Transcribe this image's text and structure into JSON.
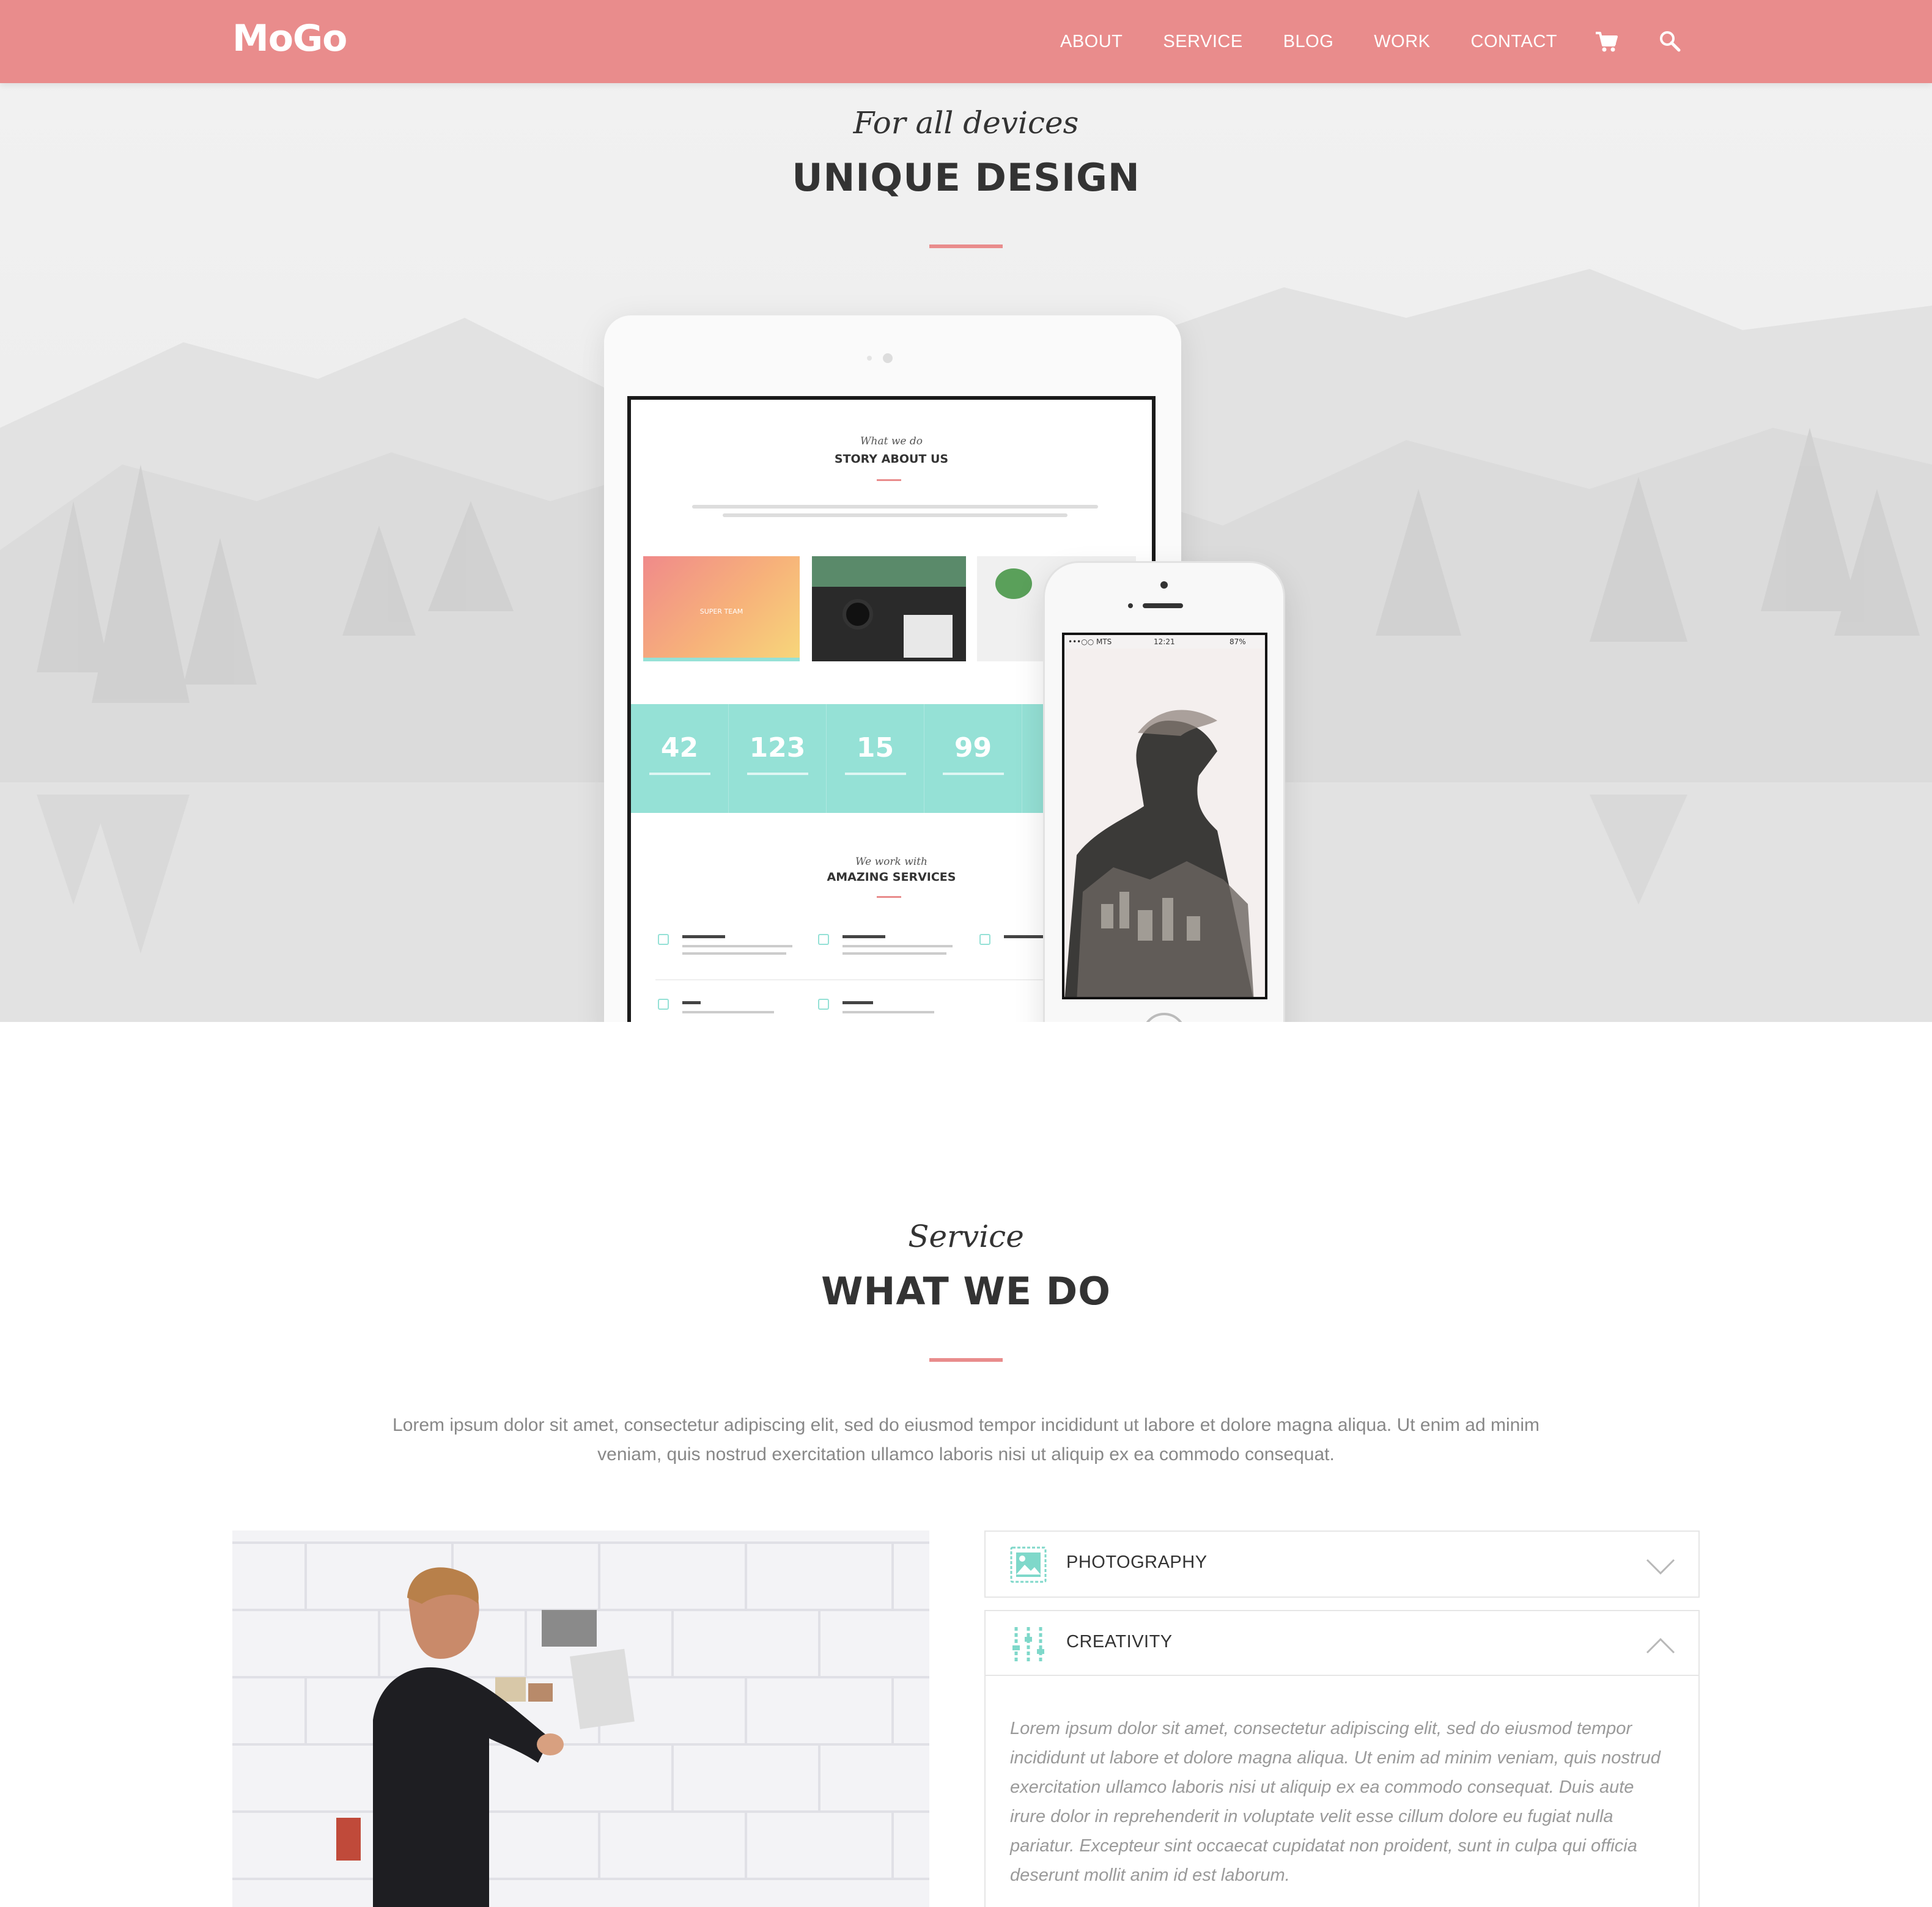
{
  "header": {
    "logo": "MoGo",
    "nav": [
      "ABOUT",
      "SERVICE",
      "BLOG",
      "WORK",
      "CONTACT"
    ],
    "icons": [
      "cart-icon",
      "search-icon"
    ]
  },
  "hero": {
    "script_title": "For all devices",
    "title": "UNIQUE DESIGN",
    "tablet": {
      "script": "What we do",
      "title": "STORY ABOUT US",
      "card_label": "SUPER TEAM",
      "stats": [
        {
          "value": "42"
        },
        {
          "value": "123"
        },
        {
          "value": "15"
        },
        {
          "value": "99"
        }
      ],
      "services_script": "We work with",
      "services_title": "AMAZING SERVICES"
    },
    "phone": {
      "carrier": "•••○○ MTS",
      "time": "12:21",
      "battery": "87%"
    }
  },
  "service": {
    "script_title": "Service",
    "title": "WHAT WE DO",
    "intro": "Lorem ipsum dolor sit amet, consectetur adipiscing elit, sed do eiusmod tempor incididunt ut labore et dolore magna aliqua. Ut enim ad minim veniam, quis nostrud exercitation ullamco laboris nisi ut aliquip ex ea commodo consequat.",
    "accordion": [
      {
        "title": "PHOTOGRAPHY",
        "icon": "image-icon",
        "expanded": false
      },
      {
        "title": "CREATIVITY",
        "icon": "equalizer-icon",
        "expanded": true,
        "body": "Lorem ipsum dolor sit amet, consectetur adipiscing elit, sed do eiusmod tempor incididunt ut labore et dolore magna aliqua. Ut enim ad minim veniam, quis nostrud exercitation ullamco laboris nisi ut aliquip ex ea commodo consequat. Duis aute irure dolor in reprehenderit in voluptate velit esse cillum dolore eu fugiat nulla pariatur. Excepteur sint occaecat cupidatat non proident, sunt in culpa qui officia deserunt mollit anim id est laborum."
      }
    ]
  },
  "colors": {
    "accent": "#e98c8c",
    "teal": "#95e1d6",
    "heading": "#333333",
    "body_text": "#888888"
  }
}
